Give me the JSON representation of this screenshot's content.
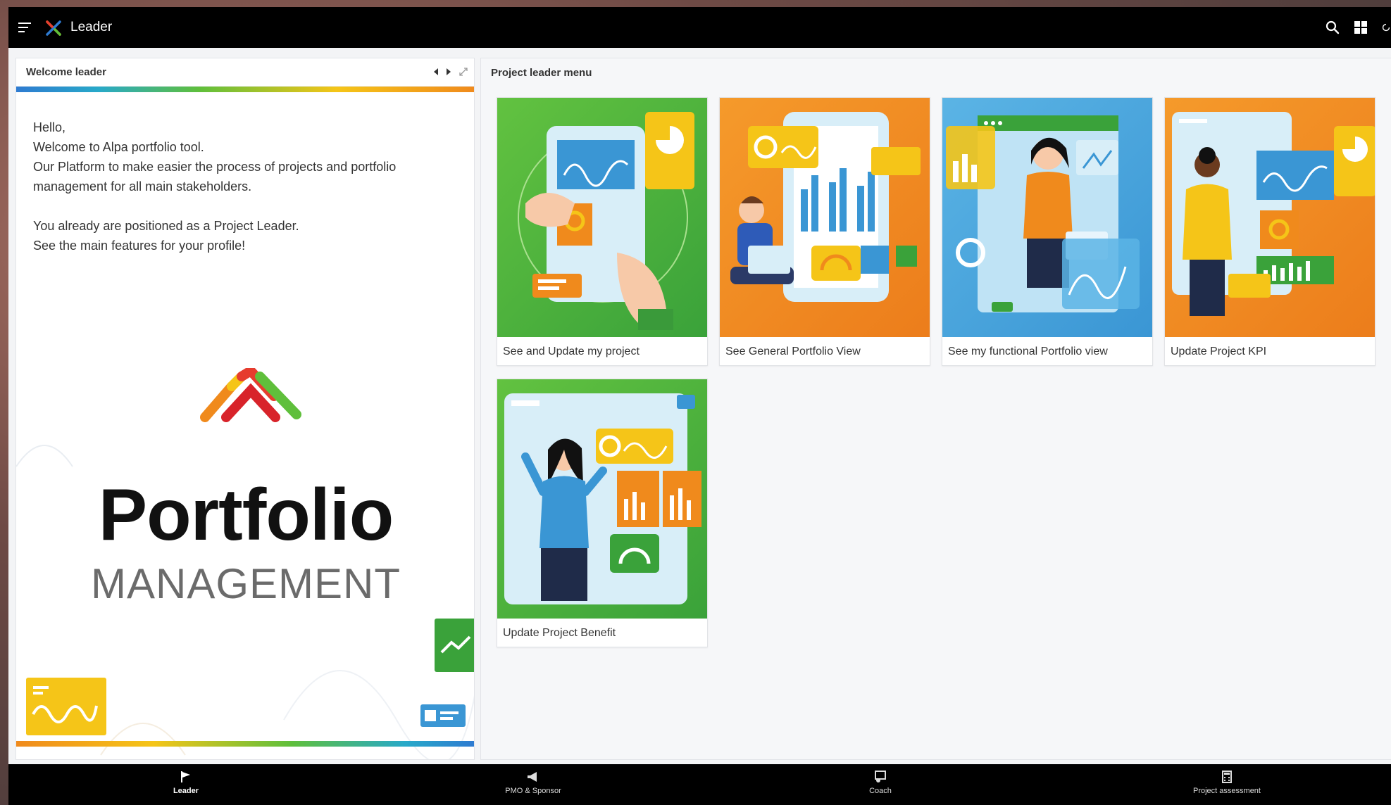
{
  "app": {
    "title": "Leader"
  },
  "left_panel": {
    "header": "Welcome leader",
    "lines": [
      "Hello,",
      "Welcome to Alpa portfolio tool.",
      "Our Platform to make easier the process of projects and portfolio",
      "management for all main stakeholders.",
      "You already are positioned as a Project Leader.",
      "See the main features for your profile!"
    ],
    "logo_title": "Portfolio",
    "logo_subtitle": "MANAGEMENT"
  },
  "right_panel": {
    "header": "Project leader menu",
    "cards": [
      {
        "label": "See and Update my project",
        "art": "green"
      },
      {
        "label": "See General Portfolio View",
        "art": "orange"
      },
      {
        "label": "See my functional Portfolio view",
        "art": "blue"
      },
      {
        "label": "Update Project KPI",
        "art": "orange"
      },
      {
        "label": "Update Project Benefit",
        "art": "green"
      }
    ]
  },
  "bottom_nav": [
    {
      "label": "Leader",
      "icon": "flag-icon"
    },
    {
      "label": "PMO & Sponsor",
      "icon": "megaphone-icon"
    },
    {
      "label": "Coach",
      "icon": "coach-icon"
    },
    {
      "label": "Project assessment",
      "icon": "calculator-icon"
    }
  ],
  "colors": {
    "bar_bg": "#000000",
    "green": "#4cae3c",
    "orange": "#f08a1c",
    "blue": "#4aa8e0",
    "yellow": "#f5c518"
  }
}
